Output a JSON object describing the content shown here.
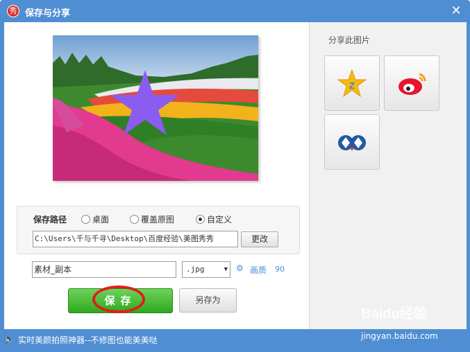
{
  "window": {
    "title": "保存与分享",
    "app_icon_text": "秀",
    "close_glyph": "✕"
  },
  "preview": {
    "icons": [
      "flower-field-photo",
      "purple-star-sticker"
    ]
  },
  "share": {
    "title": "分享此图片",
    "buttons": [
      {
        "name": "qzone",
        "icon": "qzone-star-icon"
      },
      {
        "name": "weibo",
        "icon": "weibo-icon"
      },
      {
        "name": "renren",
        "icon": "renren-icon"
      }
    ]
  },
  "save_path": {
    "label": "保存路径",
    "options": [
      {
        "label": "桌面",
        "selected": false
      },
      {
        "label": "覆盖原图",
        "selected": false
      },
      {
        "label": "自定义",
        "selected": true
      }
    ],
    "path_value": "C:\\Users\\千与千寻\\Desktop\\百度经验\\美图秀秀",
    "change_label": "更改"
  },
  "file": {
    "name_value": "素材_副本",
    "format_value": ".jpg",
    "quality_label": "画质",
    "quality_value": "90"
  },
  "actions": {
    "save_label": "保存",
    "save_as_label": "另存为"
  },
  "status": {
    "text": "实时美颜拍照神器--不修图也能美美哒"
  },
  "watermark": {
    "brand": "Baidu经验",
    "url": "jingyan.baidu.com"
  },
  "colors": {
    "titlebar": "#4f8ed3",
    "save_green": "#2ea81e",
    "highlight_red": "#e11d1d",
    "star_purple": "#8a5cf0"
  }
}
